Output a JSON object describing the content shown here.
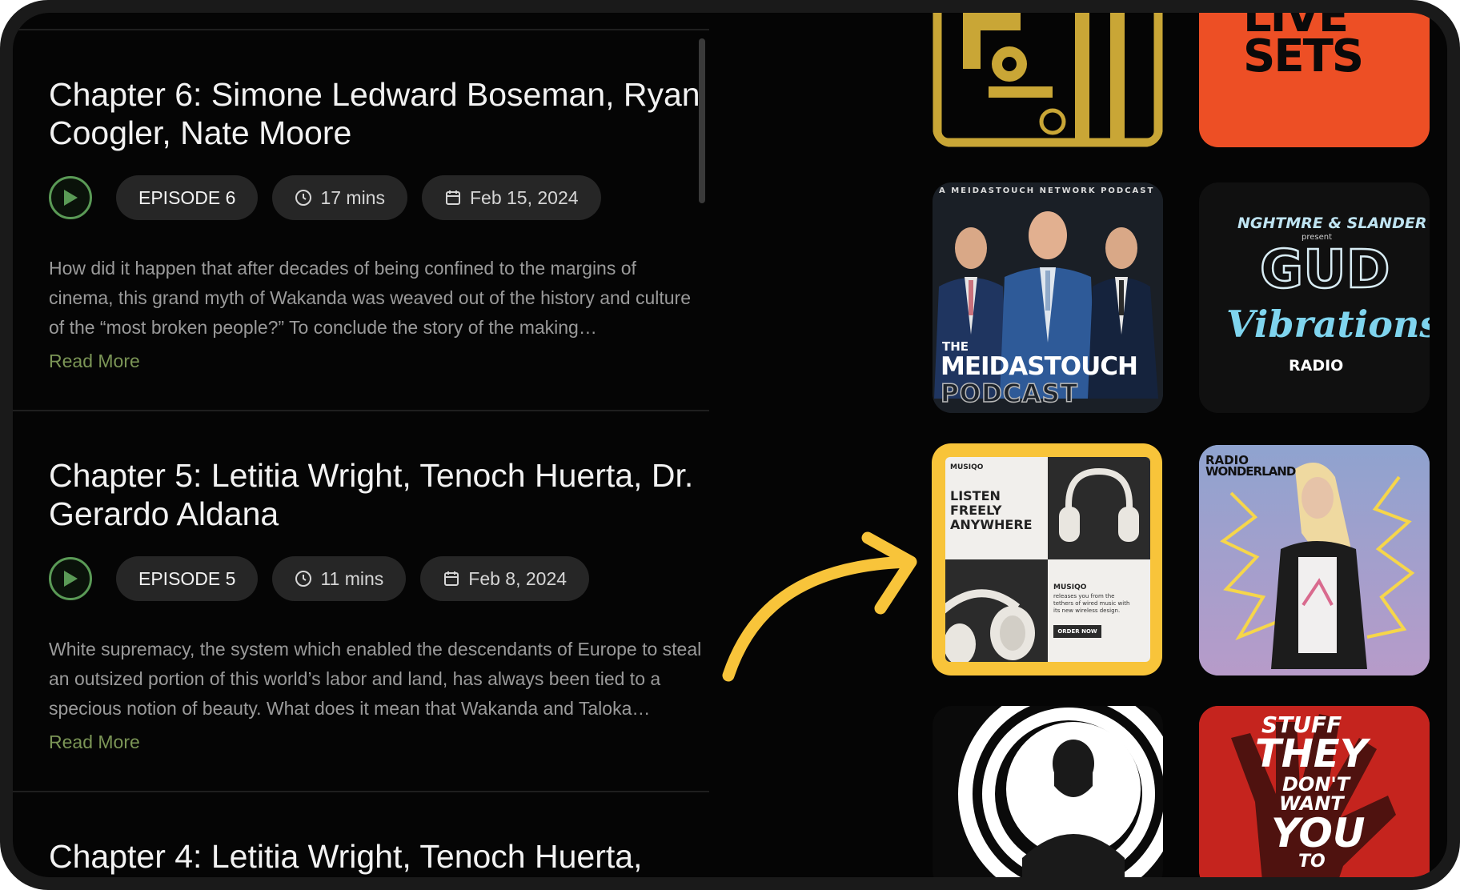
{
  "episodes": [
    {
      "title": "Chapter 6: Simone Ledward Boseman, Ryan Coogler, Nate Moore",
      "episode_label": "EPISODE 6",
      "duration": "17 mins",
      "date": "Feb 15, 2024",
      "description": "How did it happen that after decades of being confined to the margins of cinema, this grand myth of Wakanda was weaved out of the history and culture of the “most broken people?” To conclude the story of the making…",
      "read_more": "Read More"
    },
    {
      "title": "Chapter 5: Letitia Wright, Tenoch Huerta, Dr. Gerardo Aldana",
      "episode_label": "EPISODE 5",
      "duration": "11 mins",
      "date": "Feb 8, 2024",
      "description": "White supremacy, the system which enabled the descendants of Europe to steal an outsized portion of this world’s labor and land, has always been tied to a specious notion of beauty. What does it mean that Wakanda and Taloka…",
      "read_more": "Read More"
    },
    {
      "title": "Chapter 4: Letitia Wright, Tenoch Huerta,"
    }
  ],
  "podcasts": {
    "live_sets": {
      "line1": "LIVE",
      "line2": "SETS"
    },
    "meidastouch": {
      "network": "A MEIDASTOUCH NETWORK PODCAST",
      "the": "THE",
      "name": "MEIDASTOUCH",
      "podcast": "PODCAST"
    },
    "gud_vibrations": {
      "top": "NGHTMRE & SLANDER",
      "present": "present",
      "gud": "GUD",
      "vibrations": "Vibrations",
      "radio": "RADIO"
    },
    "musiqo": {
      "brand": "MUSIQO",
      "headline1": "LISTEN",
      "headline2": "FREELY",
      "headline3": "ANYWHERE",
      "name": "MUSIQO",
      "blurb1": "releases you from the",
      "blurb2": "tethers of wired music with",
      "blurb3": "its new wireless design.",
      "cta": "ORDER NOW"
    },
    "radio_wonderland": {
      "line1": "RADIO",
      "line2": "WONDERLAND"
    },
    "stuff_they": {
      "line1": "STUFF",
      "line2": "THEY",
      "line3": "DON'T",
      "line4": "WANT",
      "line5": "YOU",
      "line6": "TO"
    }
  },
  "colors": {
    "background": "#050505",
    "accent_green": "#5a9a56",
    "read_more": "#7b9556",
    "highlight": "#f8c43a",
    "arrow": "#f8c43a"
  }
}
